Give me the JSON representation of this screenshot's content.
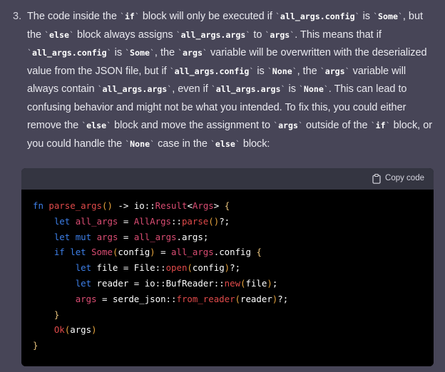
{
  "theme": {
    "page_background": "#474557",
    "code_header_background": "#343541",
    "code_body_background": "#000000",
    "text_color": "#e9e9ef",
    "inline_code_color": "#ffffff",
    "keyword_color": "#3d7fe8",
    "function_color": "#e04a4a",
    "type_color": "#d94c72",
    "punctuation_color": "#e5a33d",
    "brace_color": "#e5c07b"
  },
  "list_item": {
    "marker": "3.",
    "paragraph_segments": [
      {
        "type": "text",
        "value": "The code inside the "
      },
      {
        "type": "code",
        "value": "if"
      },
      {
        "type": "text",
        "value": " block will only be executed if "
      },
      {
        "type": "code",
        "value": "all_args.config"
      },
      {
        "type": "text",
        "value": " is "
      },
      {
        "type": "code",
        "value": "Some"
      },
      {
        "type": "text",
        "value": ", but the "
      },
      {
        "type": "code",
        "value": "else"
      },
      {
        "type": "text",
        "value": " block always assigns "
      },
      {
        "type": "code",
        "value": "all_args.args"
      },
      {
        "type": "text",
        "value": " to "
      },
      {
        "type": "code",
        "value": "args"
      },
      {
        "type": "text",
        "value": ". This means that if "
      },
      {
        "type": "code",
        "value": "all_args.config"
      },
      {
        "type": "text",
        "value": " is "
      },
      {
        "type": "code",
        "value": "Some"
      },
      {
        "type": "text",
        "value": ", the "
      },
      {
        "type": "code",
        "value": "args"
      },
      {
        "type": "text",
        "value": " variable will be overwritten with the deserialized value from the JSON file, but if "
      },
      {
        "type": "code",
        "value": "all_args.config"
      },
      {
        "type": "text",
        "value": " is "
      },
      {
        "type": "code",
        "value": "None"
      },
      {
        "type": "text",
        "value": ", the "
      },
      {
        "type": "code",
        "value": "args"
      },
      {
        "type": "text",
        "value": " variable will always contain "
      },
      {
        "type": "code",
        "value": "all_args.args"
      },
      {
        "type": "text",
        "value": ", even if "
      },
      {
        "type": "code",
        "value": "all_args.args"
      },
      {
        "type": "text",
        "value": " is "
      },
      {
        "type": "code",
        "value": "None"
      },
      {
        "type": "text",
        "value": ". This can lead to confusing behavior and might not be what you intended. To fix this, you could either remove the "
      },
      {
        "type": "code",
        "value": "else"
      },
      {
        "type": "text",
        "value": " block and move the assignment to "
      },
      {
        "type": "code",
        "value": "args"
      },
      {
        "type": "text",
        "value": " outside of the "
      },
      {
        "type": "code",
        "value": "if"
      },
      {
        "type": "text",
        "value": " block, or you could handle the "
      },
      {
        "type": "code",
        "value": "None"
      },
      {
        "type": "text",
        "value": " case in the "
      },
      {
        "type": "code",
        "value": "else"
      },
      {
        "type": "text",
        "value": " block:"
      }
    ],
    "plain_text": "3. The code inside the `if` block will only be executed if `all_args.config` is `Some`, but the `else` block always assigns `all_args.args` to `args`. This means that if `all_args.config` is `Some`, the `args` variable will be overwritten with the deserialized value from the JSON file, but if `all_args.config` is `None`, the `args` variable will always contain `all_args.args`, even if `all_args.args` is `None`. This can lead to confusing behavior and might not be what you intended. To fix this, you could either remove the `else` block and move the assignment to `args` outside of the `if` block, or you could handle the `None` case in the `else` block:"
  },
  "code_block": {
    "language": "rust",
    "copy_label": "Copy code",
    "copy_icon": "clipboard-icon",
    "lines": [
      "fn parse_args() -> io::Result<Args> {",
      "    let all_args = AllArgs::parse()?;",
      "    let mut args = all_args.args;",
      "    if let Some(config) = all_args.config {",
      "        let file = File::open(config)?;",
      "        let reader = io::BufReader::new(file);",
      "        args = serde_json::from_reader(reader)?;",
      "    }",
      "    Ok(args)",
      "}"
    ],
    "plain_text": "fn parse_args() -> io::Result<Args> {\n    let all_args = AllArgs::parse()?;\n    let mut args = all_args.args;\n    if let Some(config) = all_args.config {\n        let file = File::open(config)?;\n        let reader = io::BufReader::new(file);\n        args = serde_json::from_reader(reader)?;\n    }\n    Ok(args)\n}"
  }
}
